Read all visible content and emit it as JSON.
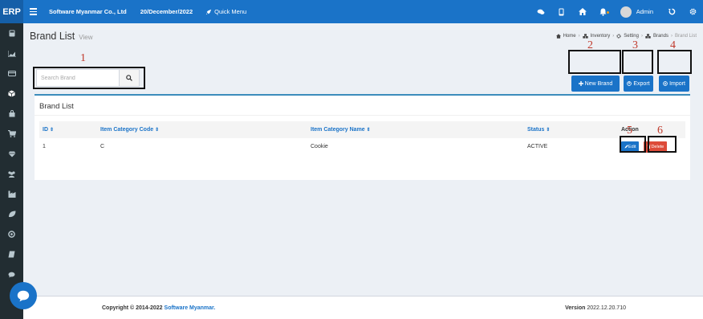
{
  "app": {
    "logo": "ERP",
    "company": "Software Myanmar Co., Ltd",
    "date": "20/December/2022",
    "quick_menu": "Quick Menu",
    "user": "Admin"
  },
  "sidebar": {
    "icons": [
      "calculator-icon",
      "chart-icon",
      "card-icon",
      "cube-icon",
      "bag-icon",
      "cart-icon",
      "diamond-icon",
      "users-icon",
      "factory-icon",
      "leaf-icon",
      "settings-wheel-icon",
      "book-icon",
      "chat-icon"
    ]
  },
  "page": {
    "title": "Brand List",
    "subtitle": "View"
  },
  "breadcrumb": {
    "home": "Home",
    "inventory": "Inventory",
    "setting": "Setting",
    "brands": "Brands",
    "current": "Brand List"
  },
  "search": {
    "placeholder": "Search Brand"
  },
  "buttons": {
    "new_brand": "New Brand",
    "export": "Export",
    "import": "Import"
  },
  "table": {
    "title": "Brand List",
    "columns": {
      "id": "ID",
      "code": "Item Category Code",
      "name": "Item Category Name",
      "status": "Status",
      "action": "Action"
    },
    "rows": [
      {
        "id": "1",
        "code": "C",
        "name": "Cookie",
        "status": "ACTIVE",
        "edit": "Edit",
        "delete": "Delete"
      }
    ]
  },
  "annotations": [
    "1",
    "2",
    "3",
    "4",
    "5",
    "6"
  ],
  "footer": {
    "copyright_prefix": "Copyright © 2014-2022 ",
    "copyright_brand": "Software Myanmar.",
    "version_label": "Version",
    "version_value": "2022.12.20.710"
  },
  "colors": {
    "primary": "#1a73c8",
    "danger": "#dd4b39",
    "sidebar": "#222d32",
    "annotation": "#c0392b"
  }
}
